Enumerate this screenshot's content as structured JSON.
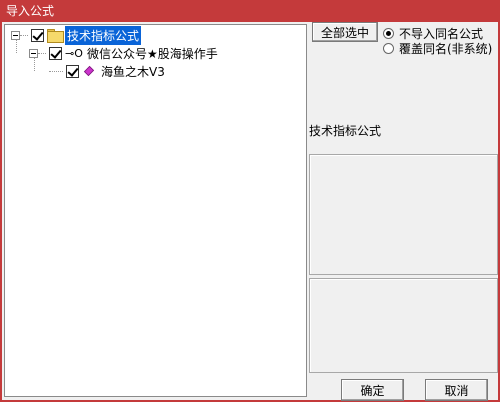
{
  "window": {
    "title": "导入公式"
  },
  "tree": {
    "root": {
      "label": "技术指标公式",
      "checked": true,
      "selected": true
    },
    "child": {
      "label": "微信公众号★股海操作手",
      "checked": true
    },
    "leaf": {
      "label": "海鱼之木V3",
      "checked": true
    }
  },
  "options": {
    "select_all_label": "全部选中",
    "radio_no_import": "不导入同名公式",
    "radio_overwrite": "覆盖同名(非系统)",
    "selected": "no_import"
  },
  "info": {
    "category_label": "技术指标公式"
  },
  "footer": {
    "ok_label": "确定",
    "cancel_label": "取消"
  },
  "colors": {
    "titlebar": "#c43a3b",
    "selection": "#0a64d8"
  }
}
